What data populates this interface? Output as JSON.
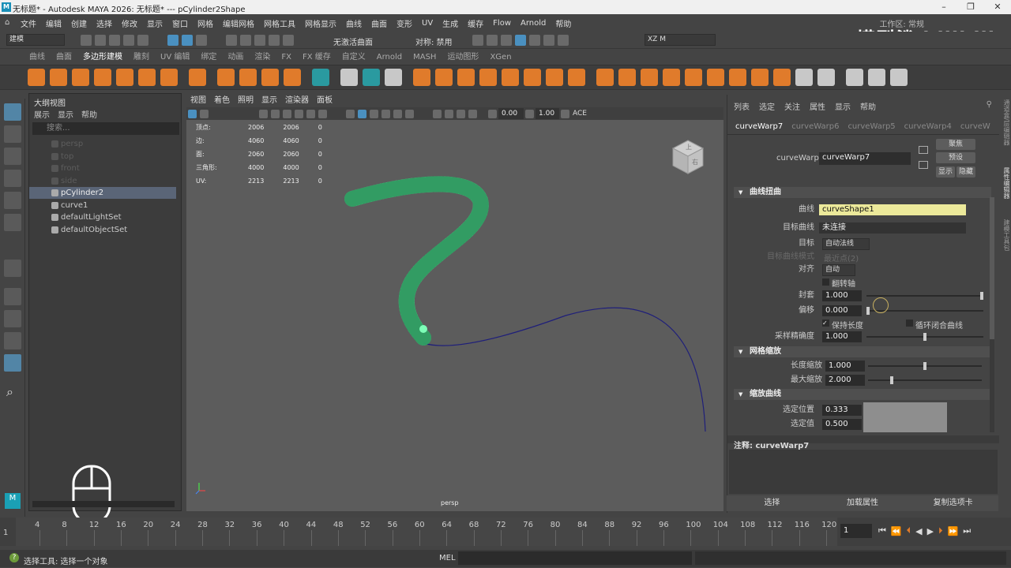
{
  "titlebar": {
    "title": "无标题* - Autodesk MAYA 2026: 无标题*   ---   pCylinder2Shape",
    "logo": "M"
  },
  "menubar": {
    "items": [
      "文件",
      "编辑",
      "创建",
      "选择",
      "修改",
      "显示",
      "窗口",
      "网格",
      "编辑网格",
      "网格工具",
      "网格显示",
      "曲线",
      "曲面",
      "变形",
      "UV",
      "生成",
      "缓存",
      "Flow",
      "Arnold",
      "帮助"
    ],
    "workspace": "工作区: 常规"
  },
  "watermark": "模型鲨 bilibili",
  "statusline": {
    "mode": "建模",
    "live": "无激活曲面",
    "symmetry": "对称: 禁用",
    "user": "XZ M"
  },
  "shelf": {
    "tabs": [
      "曲线",
      "曲面",
      "多边形建模",
      "雕刻",
      "UV 编辑",
      "绑定",
      "动画",
      "渲染",
      "FX",
      "FX 缓存",
      "自定义",
      "Arnold",
      "MASH",
      "运动图形",
      "XGen"
    ],
    "active": "多边形建模"
  },
  "outliner": {
    "title": "大纲视图",
    "menu": [
      "展示",
      "显示",
      "帮助"
    ],
    "search_placeholder": "搜索...",
    "items": [
      {
        "label": "persp",
        "dim": true
      },
      {
        "label": "top",
        "dim": true
      },
      {
        "label": "front",
        "dim": true
      },
      {
        "label": "side",
        "dim": true
      },
      {
        "label": "pCylinder2",
        "sel": true
      },
      {
        "label": "curve1"
      },
      {
        "label": "defaultLightSet"
      },
      {
        "label": "defaultObjectSet"
      }
    ]
  },
  "viewport": {
    "menu": [
      "视图",
      "着色",
      "照明",
      "显示",
      "渲染器",
      "面板"
    ],
    "values": [
      "0.00",
      "1.00"
    ],
    "ace": "ACE",
    "camera": "persp",
    "hud": [
      [
        "顶点:",
        "2006",
        "2006",
        "0"
      ],
      [
        "边:",
        "4060",
        "4060",
        "0"
      ],
      [
        "面:",
        "2060",
        "2060",
        "0"
      ],
      [
        "三角形:",
        "4000",
        "4000",
        "0"
      ],
      [
        "UV:",
        "2213",
        "2213",
        "0"
      ]
    ],
    "cube_labels": [
      "上",
      "右"
    ]
  },
  "attr": {
    "menu": [
      "列表",
      "选定",
      "关注",
      "属性",
      "显示",
      "帮助"
    ],
    "tabs": [
      "curveWarp7",
      "curveWarp6",
      "curveWarp5",
      "curveWarp4",
      "curveW"
    ],
    "node_label": "curveWarp:",
    "node_name": "curveWarp7",
    "buttons": [
      "聚焦",
      "预设",
      "显示",
      "隐藏"
    ],
    "sections": [
      "曲线扭曲",
      "网格缩放",
      "缩放曲线"
    ],
    "curve_label": "曲线",
    "curve_value": "curveShape1",
    "target_curve_label": "目标曲线",
    "target_curve_value": "未连接",
    "target_label": "目标",
    "target_value": "自动法线",
    "target_mode_label": "目标曲线模式",
    "target_mode_value": "最近点(2)",
    "align_label": "对齐",
    "align_value": "自动",
    "flip_label": "翻转轴",
    "offset_label": "封套",
    "offset_value": "1.000",
    "shift_label": "偏移",
    "shift_value": "0.000",
    "keep_length": "保持长度",
    "loop": "循环闭合曲线",
    "sample_label": "采样精确度",
    "sample_value": "1.000",
    "len_scale_label": "长度缩放",
    "len_scale_value": "1.000",
    "max_scale_label": "最大缩放",
    "max_scale_value": "2.000",
    "sel_pos_label": "选定位置",
    "sel_pos_value": "0.333",
    "sel_val_label": "选定值",
    "sel_val_value": "0.500",
    "notes": "注释: curveWarp7",
    "bottom": [
      "选择",
      "加载属性",
      "复制选项卡"
    ]
  },
  "timeline": {
    "ticks": [
      "4",
      "8",
      "12",
      "16",
      "20",
      "24",
      "28",
      "32",
      "36",
      "40",
      "44",
      "48",
      "52",
      "56",
      "60",
      "64",
      "68",
      "72",
      "76",
      "80",
      "84",
      "88",
      "92",
      "96",
      "100",
      "104",
      "108",
      "112",
      "116",
      "120"
    ],
    "start": "1",
    "current": "1"
  },
  "cmdline": {
    "help": "选择工具: 选择一个对象",
    "lang": "MEL"
  },
  "right_strip": [
    "通道盒/层编辑器",
    "属性编辑器",
    "建模工具包"
  ],
  "colors": {
    "accent": "#5285a6",
    "mesh": "#4dff9a",
    "curve": "#1f1f7a",
    "highlight": "#ece99a"
  }
}
